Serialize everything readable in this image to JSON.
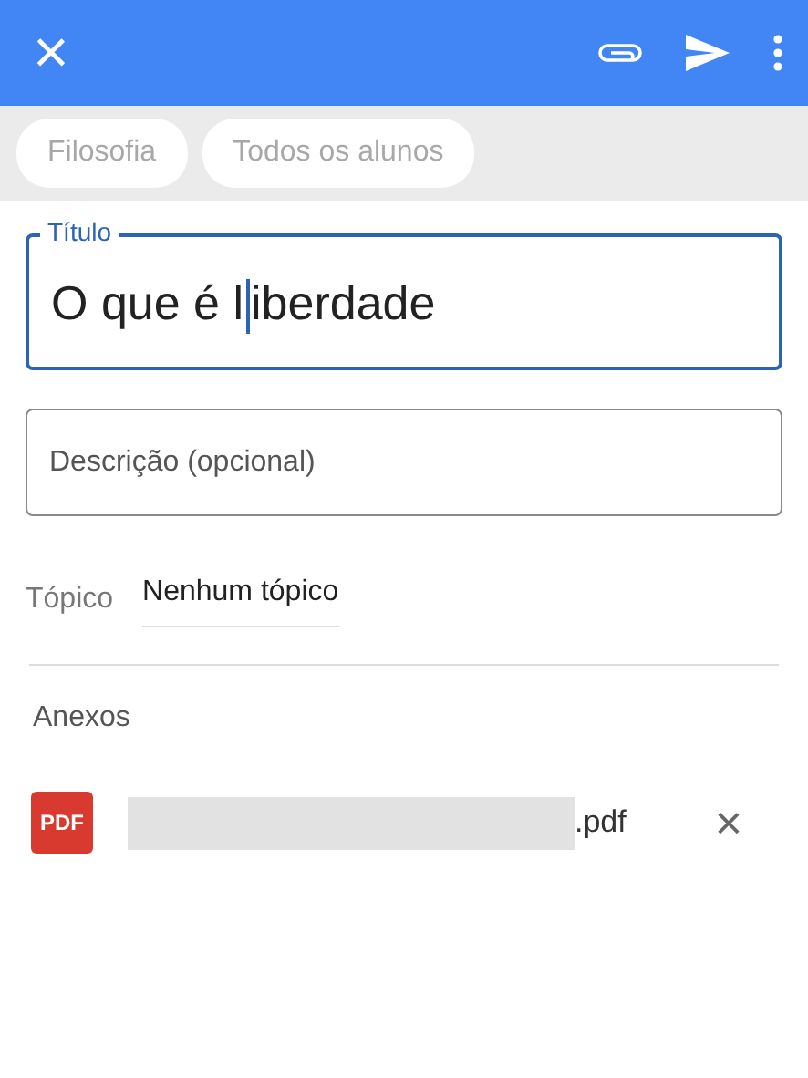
{
  "toolbar": {
    "close": "×"
  },
  "chips": [
    {
      "label": "Filosofia"
    },
    {
      "label": "Todos os alunos"
    }
  ],
  "title_field": {
    "label": "Título",
    "value_before_cursor": "O que é l",
    "value_after_cursor": "iberdade",
    "focused": true
  },
  "description_field": {
    "placeholder": "Descrição (opcional)"
  },
  "topic": {
    "label": "Tópico",
    "value": "Nenhum tópico"
  },
  "attachments": {
    "heading": "Anexos",
    "items": [
      {
        "type_label": "PDF",
        "name_redacted": true,
        "extension": ".pdf",
        "remove": "×"
      }
    ]
  }
}
